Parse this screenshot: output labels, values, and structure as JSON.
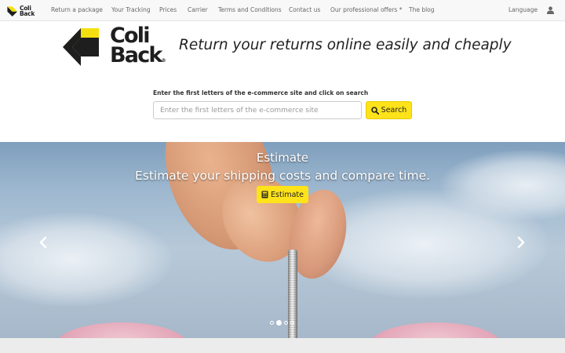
{
  "brand": {
    "line1": "Coli",
    "line2": "Back",
    "registered": "®"
  },
  "nav": {
    "items": [
      "Return a package",
      "Your Tracking",
      "Prices",
      "Carrier",
      "Terms and Conditions",
      "Contact us",
      "Our professional offers *",
      "The blog"
    ],
    "language": "Language",
    "user_icon": "user-icon"
  },
  "header": {
    "tagline": "Return your returns online easily and cheaply"
  },
  "search": {
    "label": "Enter the first letters of the e-commerce site and click on search",
    "placeholder": "Enter the first letters of the e-commerce site",
    "button_label": "Search",
    "button_icon": "search-icon"
  },
  "carousel": {
    "title": "Estimate",
    "caption": "Estimate your shipping costs and compare time.",
    "button_label": "Estimate",
    "button_icon": "calculator-icon",
    "slide_count": 3,
    "active_slide": 2
  },
  "colors": {
    "accent": "#ffe31a",
    "logo_yellow": "#f4e010",
    "logo_dark": "#1e1e1e",
    "navbar_bg": "#f8f8f8"
  }
}
